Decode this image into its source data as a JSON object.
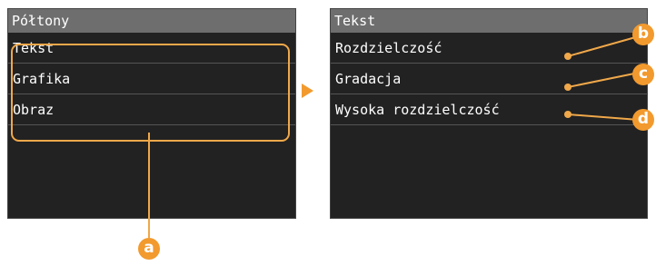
{
  "left_screen": {
    "title": "Półtony",
    "items": [
      "Tekst",
      "Grafika",
      "Obraz"
    ]
  },
  "right_screen": {
    "title": "Tekst",
    "items": [
      "Rozdzielczość",
      "Gradacja",
      "Wysoka rozdzielczość"
    ]
  },
  "callouts": {
    "a": "a",
    "b": "b",
    "c": "c",
    "d": "d"
  },
  "colors": {
    "screen_bg": "#222222",
    "header_bg": "#6e6e6e",
    "accent": "#f29a2e",
    "highlight": "#f0a84a"
  },
  "icons": {
    "navigation_arrow": "play-arrow-icon"
  }
}
